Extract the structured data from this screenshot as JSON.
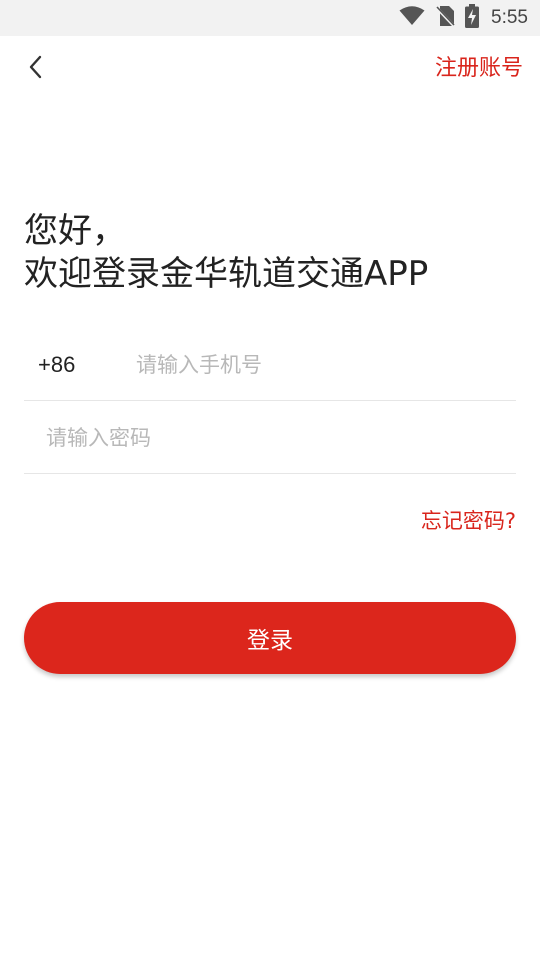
{
  "status_bar": {
    "time": "5:55",
    "icons": [
      "wifi-icon",
      "no-sim-icon",
      "battery-charging-icon"
    ]
  },
  "header": {
    "back_icon": "chevron-left-icon",
    "register_label": "注册账号"
  },
  "greeting": {
    "line1": "您好，",
    "line2": "欢迎登录金华轨道交通APP"
  },
  "form": {
    "country_code": "+86",
    "phone_placeholder": "请输入手机号",
    "password_placeholder": "请输入密码",
    "forgot_password_label": "忘记密码?",
    "login_label": "登录"
  },
  "colors": {
    "accent": "#dc261c",
    "status_bar_bg": "#f2f2f2",
    "placeholder": "#b8b8b8"
  }
}
